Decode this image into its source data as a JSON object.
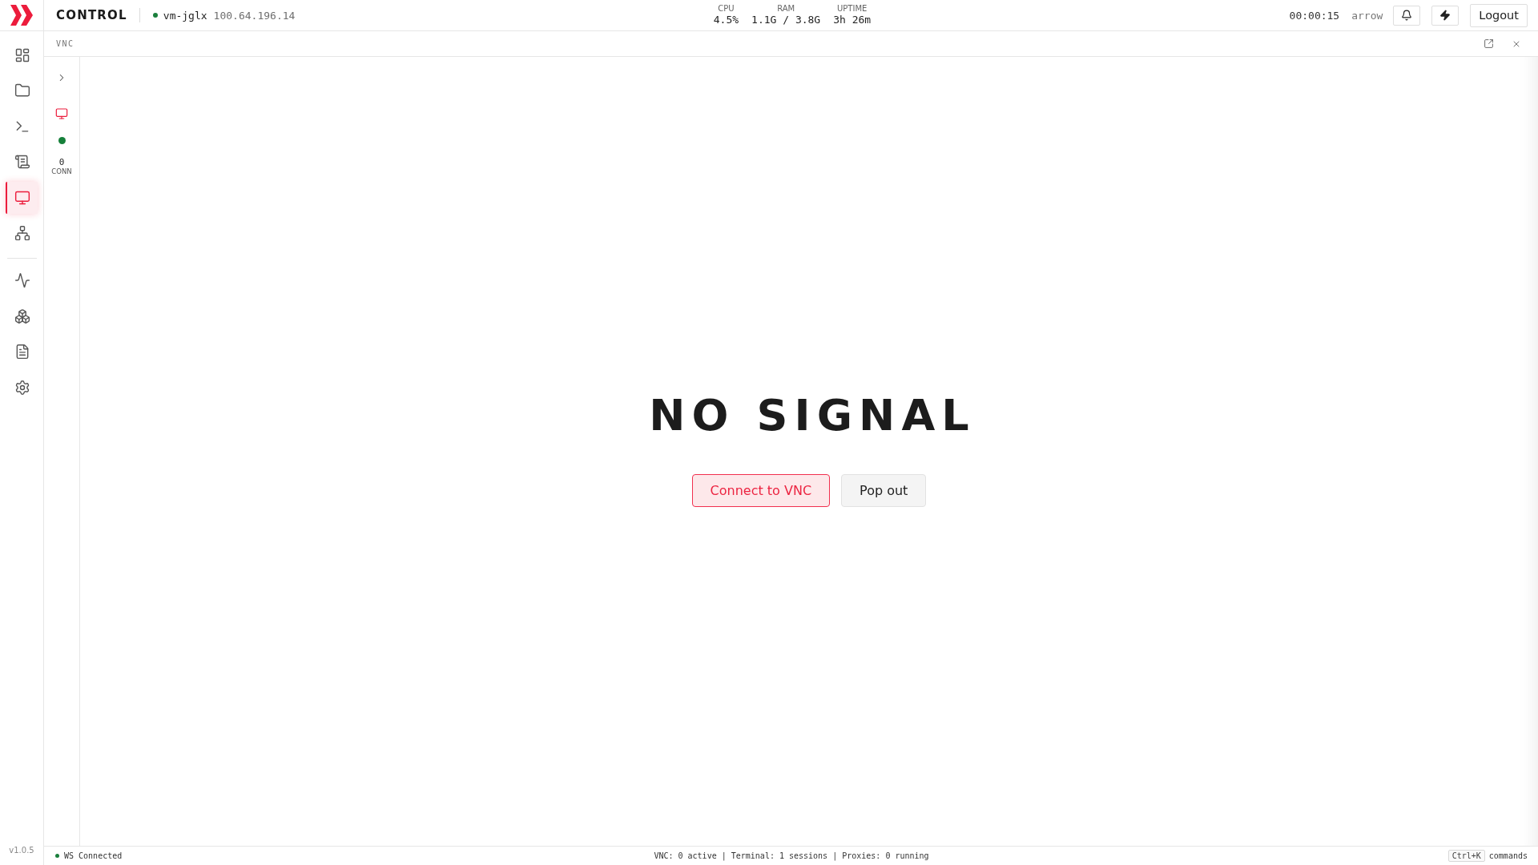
{
  "sidebar": {
    "groups": [
      {
        "items": [
          {
            "selected": false
          },
          {
            "selected": false
          },
          {
            "selected": false
          },
          {
            "selected": false
          },
          {
            "selected": true
          },
          {
            "selected": false
          }
        ]
      },
      {
        "items": [
          {
            "selected": false
          },
          {
            "selected": false
          },
          {
            "selected": false
          },
          {
            "selected": false
          }
        ]
      }
    ],
    "version": "v1.0.5"
  },
  "header": {
    "brand": "CONTROL",
    "host": {
      "online": true,
      "name": "vm-jglx",
      "address": "100.64.196.14"
    },
    "stats": [
      {
        "label": "CPU",
        "value": "4.5%"
      },
      {
        "label": "RAM",
        "value": "1.1G / 3.8G"
      },
      {
        "label": "UPTIME",
        "value": "3h 26m"
      }
    ],
    "clock": "00:00:15",
    "user": "arrow",
    "logout": "Logout"
  },
  "panel": {
    "title": "VNC"
  },
  "rail": {
    "online": true,
    "count": "0",
    "count_label": "CONN"
  },
  "screen": {
    "message": "NO SIGNAL",
    "actions": [
      {
        "kind": "primary",
        "label": "Connect to VNC"
      },
      {
        "kind": "secondary",
        "label": "Pop out"
      }
    ]
  },
  "status_bar": {
    "ws": {
      "connected": true,
      "label": "WS Connected"
    },
    "summary": "VNC: 0 active | Terminal: 1 sessions | Proxies: 0 running",
    "shortcut": {
      "key": "Ctrl+K",
      "label": "commands"
    }
  }
}
